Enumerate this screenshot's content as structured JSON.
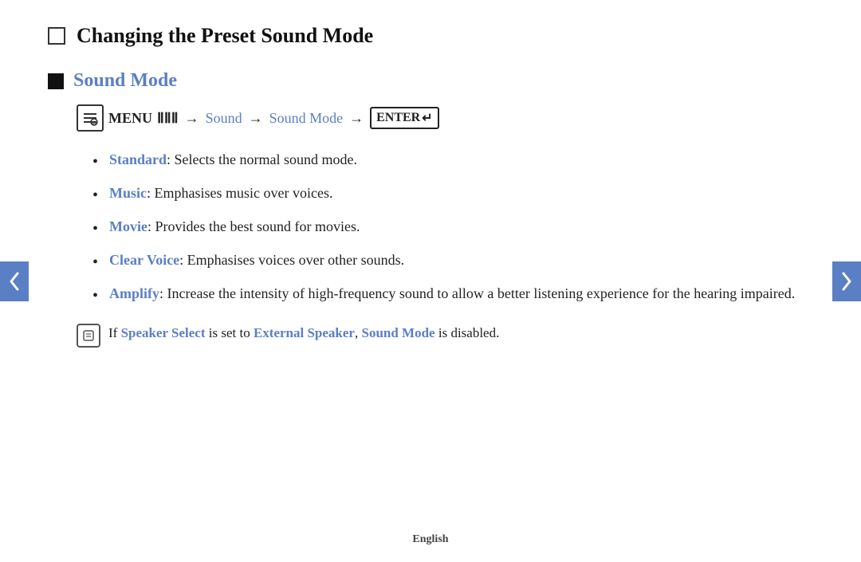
{
  "page": {
    "title": "Changing the Preset Sound Mode",
    "footer": "English"
  },
  "section": {
    "heading": "Sound Mode",
    "menu": {
      "icon_label": "m",
      "menu_label": "MENU",
      "menu_symbol": "|||",
      "arrow": "→",
      "sound_link": "Sound",
      "sound_mode_link": "Sound Mode",
      "enter_label": "ENTER"
    },
    "bullets": [
      {
        "term": "Standard",
        "text": ": Selects the normal sound mode."
      },
      {
        "term": "Music",
        "text": ": Emphasises music over voices."
      },
      {
        "term": "Movie",
        "text": ": Provides the best sound for movies."
      },
      {
        "term": "Clear Voice",
        "text": ": Emphasises voices over other sounds."
      },
      {
        "term": "Amplify",
        "text": ": Increase the intensity of high-frequency sound to allow a better listening experience for the hearing impaired."
      }
    ],
    "note": {
      "text_before": "If ",
      "speaker_select": "Speaker Select",
      "text_mid1": " is set to ",
      "external_speaker": "External Speaker",
      "text_mid2": ", ",
      "sound_mode": "Sound Mode",
      "text_after": " is disabled."
    }
  },
  "nav": {
    "left_label": "previous",
    "right_label": "next"
  }
}
